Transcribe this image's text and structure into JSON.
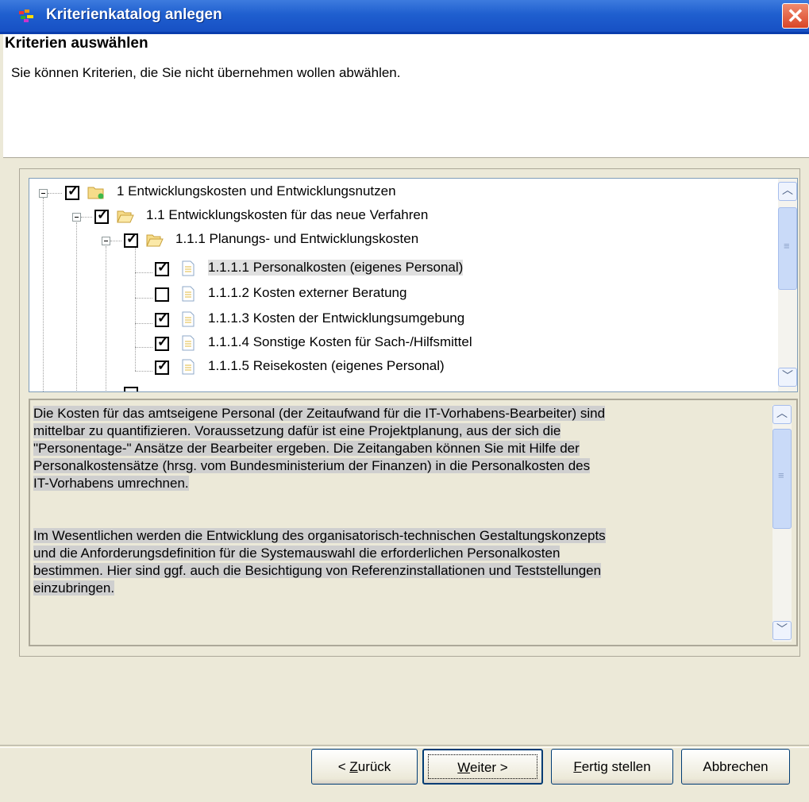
{
  "window": {
    "title": "Kriterienkatalog anlegen",
    "close_glyph": "✕"
  },
  "header": {
    "title": "Kriterien auswählen",
    "description": "Sie können Kriterien, die Sie nicht übernehmen wollen abwählen."
  },
  "tree": {
    "items": [
      {
        "label": "1 Entwicklungskosten und Entwicklungsnutzen",
        "checked": true,
        "icon": "folder-closed-icon",
        "level": 0
      },
      {
        "label": "1.1 Entwicklungskosten für das neue Verfahren",
        "checked": true,
        "icon": "folder-open-icon",
        "level": 1
      },
      {
        "label": "1.1.1 Planungs- und Entwicklungskosten",
        "checked": true,
        "icon": "folder-open-icon",
        "level": 2
      },
      {
        "label": "1.1.1.1 Personalkosten (eigenes Personal)",
        "checked": true,
        "icon": "document-icon",
        "level": 3,
        "selected": true
      },
      {
        "label": "1.1.1.2 Kosten externer Beratung",
        "checked": false,
        "icon": "document-icon",
        "level": 3
      },
      {
        "label": "1.1.1.3 Kosten der Entwicklungsumgebung",
        "checked": true,
        "icon": "document-icon",
        "level": 3
      },
      {
        "label": "1.1.1.4 Sonstige Kosten für Sach-/Hilfsmittel",
        "checked": true,
        "icon": "document-icon",
        "level": 3
      },
      {
        "label": "1.1.1.5 Reisekosten (eigenes Personal)",
        "checked": true,
        "icon": "document-icon",
        "level": 3
      }
    ]
  },
  "description": {
    "paragraph1": [
      "Die Kosten für das amtseigene Personal (der Zeitaufwand für die IT-Vorhabens-Bearbeiter) sind",
      "mittelbar zu quantifizieren. Voraussetzung dafür ist eine Projektplanung, aus der sich die",
      "\"Personentage-\" Ansätze der Bearbeiter ergeben. Die Zeitangaben können Sie mit Hilfe der",
      "Personalkostensätze (hrsg. vom Bundesministerium der Finanzen) in die Personalkosten des",
      "IT-Vorhabens umrechnen."
    ],
    "paragraph2": [
      "Im Wesentlichen werden die Entwicklung des organisatorisch-technischen Gestaltungskonzepts",
      "und die Anforderungsdefinition für die Systemauswahl die erforderlichen Personalkosten",
      "bestimmen. Hier sind ggf. auch die Besichtigung von Referenzinstallationen und Teststellungen",
      "einzubringen."
    ]
  },
  "buttons": {
    "back": {
      "prefix": "< ",
      "mnemonic": "Z",
      "rest": "urück"
    },
    "next": {
      "mnemonic": "W",
      "rest": "eiter >"
    },
    "finish": {
      "mnemonic": "F",
      "rest": "ertig stellen"
    },
    "cancel": {
      "label": "Abbrechen"
    }
  },
  "colors": {
    "titlebar": "#1f5fcf",
    "selection": "#e0e0e0",
    "dialog_bg": "#ece9d8"
  }
}
